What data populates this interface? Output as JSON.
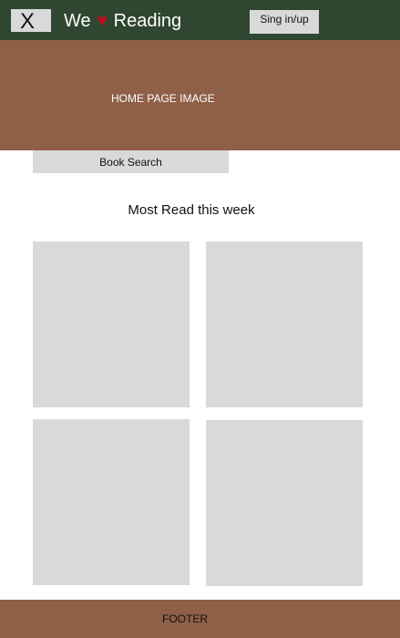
{
  "header": {
    "close_label": "X",
    "brand_prefix": "We",
    "brand_heart": "♥",
    "brand_suffix": "Reading",
    "sign_label": "Sing in/up"
  },
  "hero": {
    "label": "HOME PAGE IMAGE"
  },
  "search": {
    "label": "Book Search"
  },
  "most_read": {
    "title": "Most Read this week"
  },
  "footer": {
    "label": "FOOTER"
  },
  "colors": {
    "header_bg": "#2f4730",
    "hero_bg": "#8f5f48",
    "placeholder_gray": "#d9d9d9",
    "heart": "#b3121a",
    "footer_bg": "#8f5f48"
  },
  "icons": {
    "heart": "heart-icon"
  }
}
